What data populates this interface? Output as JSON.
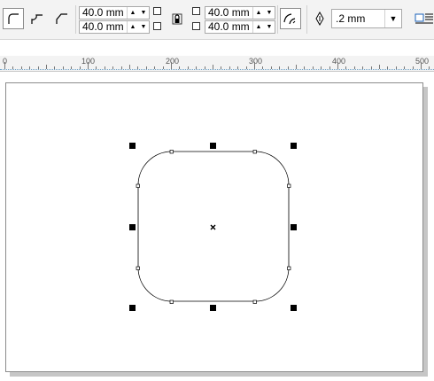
{
  "toolbar": {
    "corner_width_top": "40.0 mm",
    "corner_width_bottom": "40.0 mm",
    "corner_radius_top": "40.0 mm",
    "corner_radius_bottom": "40.0 mm",
    "outline_width": ".2 mm",
    "icons": [
      "round-corner-icon",
      "scalloped-corner-icon",
      "chamfer-corner-icon",
      "lock-icon",
      "scale-corners-icon",
      "pen-nib-icon",
      "wrap-text-icon"
    ]
  },
  "ruler": {
    "labels": [
      "0",
      "100",
      "200",
      "300",
      "400",
      "500"
    ]
  },
  "canvas": {
    "shape": "rounded-rectangle"
  }
}
